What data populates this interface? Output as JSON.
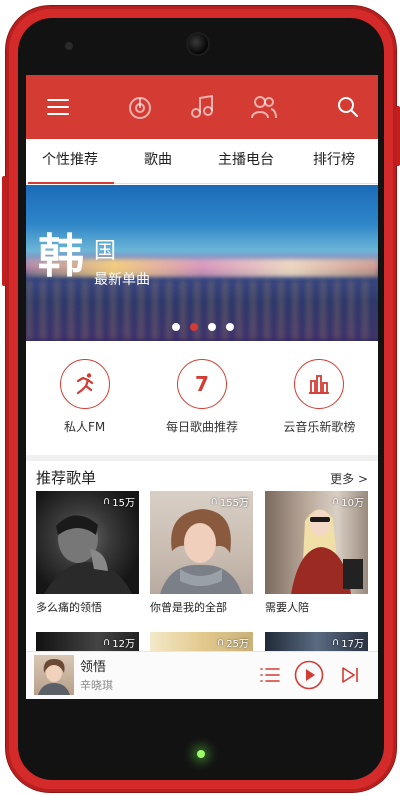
{
  "tabs": [
    {
      "label": "个性推荐"
    },
    {
      "label": "歌曲"
    },
    {
      "label": "主播电台"
    },
    {
      "label": "排行榜"
    }
  ],
  "banner": {
    "big_char": "韩",
    "mid_char": "国",
    "subtitle": "最新单曲",
    "slide_count": 4,
    "active_slide": 1
  },
  "quick": [
    {
      "label": "私人FM",
      "icon": "running-person-icon"
    },
    {
      "label": "每日歌曲推荐",
      "icon": "calendar-day-icon",
      "glyph": "7"
    },
    {
      "label": "云音乐新歌榜",
      "icon": "bar-chart-icon"
    }
  ],
  "section": {
    "title": "推荐歌单",
    "more": "更多 >"
  },
  "playlists": [
    {
      "title": "多么痛的领悟",
      "count": "15万"
    },
    {
      "title": "你曾是我的全部",
      "count": "155万"
    },
    {
      "title": "需要人陪",
      "count": "10万"
    },
    {
      "title": "",
      "count": "12万"
    },
    {
      "title": "",
      "count": "25万"
    },
    {
      "title": "",
      "count": "17万"
    }
  ],
  "player": {
    "song": "领悟",
    "artist": "辛晓琪"
  },
  "colors": {
    "accent": "#d43c33",
    "phone_body": "#d42a2a"
  }
}
